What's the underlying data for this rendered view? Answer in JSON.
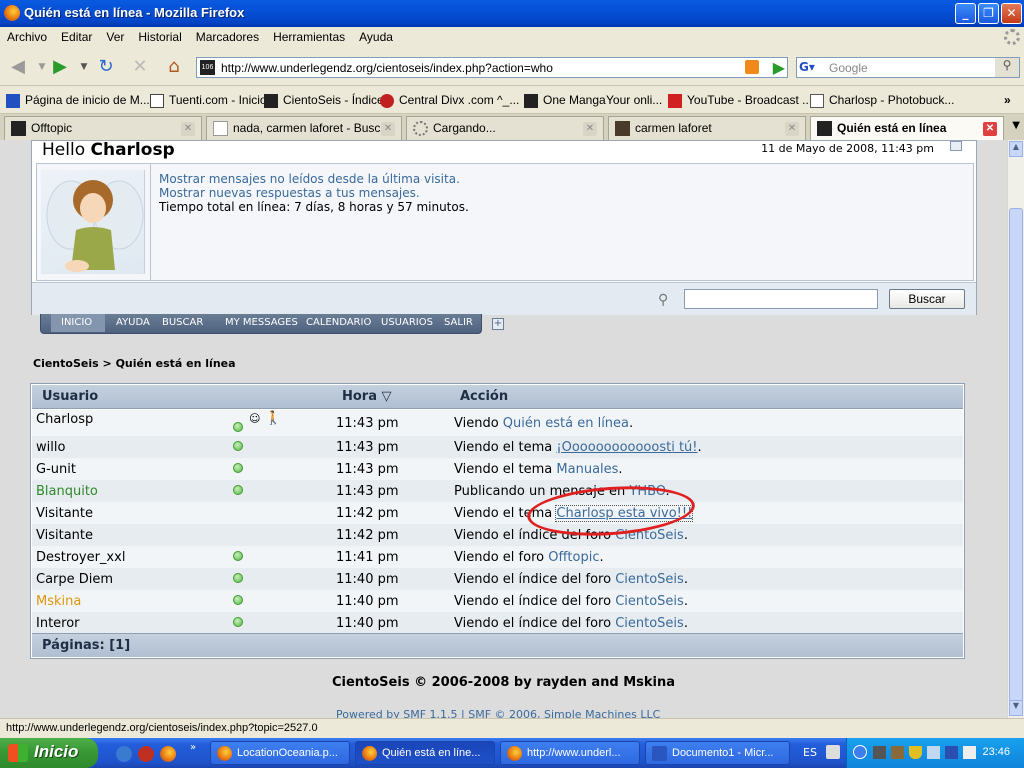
{
  "window": {
    "title": "Quién está en línea - Mozilla Firefox"
  },
  "menu": [
    "Archivo",
    "Editar",
    "Ver",
    "Historial",
    "Marcadores",
    "Herramientas",
    "Ayuda"
  ],
  "nav": {
    "url": "http://www.underlegendz.org/cientoseis/index.php?action=who",
    "search_placeholder": "Google"
  },
  "bookmarks": [
    "Página de inicio de M...",
    "Tuenti.com - Inicio",
    "CientoSeis - Índice",
    "Central Divx .com ^_...",
    "One Manga",
    "Your onli...",
    "YouTube - Broadcast ...",
    "Charlosp - Photobuck..."
  ],
  "tabs": [
    {
      "label": "Offtopic"
    },
    {
      "label": "nada, carmen laforet - Busc..."
    },
    {
      "label": "Cargando..."
    },
    {
      "label": "carmen laforet"
    },
    {
      "label": "Quién está en línea"
    }
  ],
  "page": {
    "hello": "Hello",
    "username": "Charlosp",
    "datetime": "11 de Mayo de 2008, 11:43 pm",
    "link_unread": "Mostrar mensajes no leídos desde la última visita.",
    "link_replies": "Mostrar nuevas respuestas a tus mensajes.",
    "online_time": "Tiempo total en línea: 7 días, 8 horas y 57 minutos.",
    "search_button": "Buscar",
    "navmenu": [
      "INICIO",
      "AYUDA",
      "BUSCAR",
      "MY MESSAGES",
      "CALENDARIO",
      "USUARIOS",
      "SALIR"
    ],
    "breadcrumb": [
      "CientoSeis",
      ">",
      "Quién está en línea"
    ],
    "table": {
      "headers": {
        "user": "Usuario",
        "time": "Hora",
        "action": "Acción"
      },
      "rows": [
        {
          "user": "Charlosp",
          "time": "11:43 pm",
          "action": "Viendo ",
          "link": "Quién está en línea",
          "end": "."
        },
        {
          "user": "willo",
          "time": "11:43 pm",
          "action": "Viendo el tema ",
          "link": "¡Oooooooooooosti tú!",
          "end": "."
        },
        {
          "user": "G-unit",
          "time": "11:43 pm",
          "action": "Viendo el tema ",
          "link": "Manuales",
          "end": "."
        },
        {
          "user": "Blanquito",
          "time": "11:43 pm",
          "action": "Publicando un mensaje en ",
          "link": "YHBO",
          "end": "."
        },
        {
          "user": "Visitante",
          "time": "11:42 pm",
          "action": "Viendo el tema ",
          "link": "Charlosp esta vivo!!!",
          "end": ""
        },
        {
          "user": "Visitante",
          "time": "11:42 pm",
          "action": "Viendo el índice del foro ",
          "link": "CientoSeis",
          "end": "."
        },
        {
          "user": "Destroyer_xxl",
          "time": "11:41 pm",
          "action": "Viendo el foro ",
          "link": "Offtopic",
          "end": "."
        },
        {
          "user": "Carpe Diem",
          "time": "11:40 pm",
          "action": "Viendo el índice del foro ",
          "link": "CientoSeis",
          "end": "."
        },
        {
          "user": "Mskina",
          "time": "11:40 pm",
          "action": "Viendo el índice del foro ",
          "link": "CientoSeis",
          "end": "."
        },
        {
          "user": "Interor",
          "time": "11:40 pm",
          "action": "Viendo el índice del foro ",
          "link": "CientoSeis",
          "end": "."
        }
      ],
      "pages": "Páginas: [1]"
    },
    "copyright": "CientoSeis © 2006-2008 by rayden and Mskina",
    "powered": "Powered by SMF 1.1.5 | SMF © 2006, Simple Machines LLC"
  },
  "status": "http://www.underlegendz.org/cientoseis/index.php?topic=2527.0",
  "taskbar": {
    "start": "Inicio",
    "tasks": [
      "LocationOceania.p...",
      "Quién está en líne...",
      "http://www.underl...",
      "Documento1 - Micr..."
    ],
    "lang": "ES",
    "clock": "23:46"
  },
  "colors": {
    "user_green": "#2f8a2a",
    "user_orange": "#e0960a",
    "link": "#3a6a9a",
    "annotation_red": "#e02020"
  }
}
